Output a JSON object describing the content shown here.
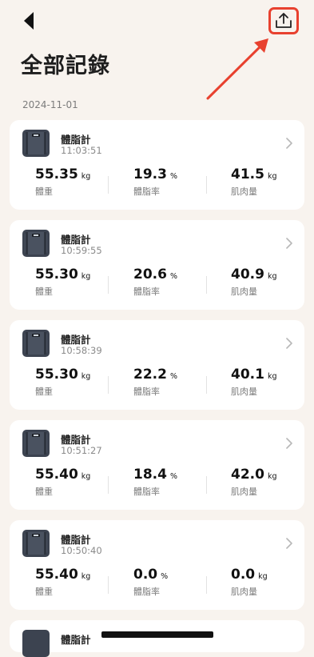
{
  "header": {
    "title": "全部記錄",
    "back_icon": "back-arrow-icon",
    "export_icon": "share-upload-icon",
    "accent_color": "#e8412f"
  },
  "date_group": "2024-11-01",
  "records": [
    {
      "device": "體脂計",
      "time": "11:03:51",
      "weight": "55.35",
      "weight_unit": "kg",
      "weight_label": "體重",
      "fat": "19.3",
      "fat_unit": "%",
      "fat_label": "體脂率",
      "muscle": "41.5",
      "muscle_unit": "kg",
      "muscle_label": "肌肉量"
    },
    {
      "device": "體脂計",
      "time": "10:59:55",
      "weight": "55.30",
      "weight_unit": "kg",
      "weight_label": "體重",
      "fat": "20.6",
      "fat_unit": "%",
      "fat_label": "體脂率",
      "muscle": "40.9",
      "muscle_unit": "kg",
      "muscle_label": "肌肉量"
    },
    {
      "device": "體脂計",
      "time": "10:58:39",
      "weight": "55.30",
      "weight_unit": "kg",
      "weight_label": "體重",
      "fat": "22.2",
      "fat_unit": "%",
      "fat_label": "體脂率",
      "muscle": "40.1",
      "muscle_unit": "kg",
      "muscle_label": "肌肉量"
    },
    {
      "device": "體脂計",
      "time": "10:51:27",
      "weight": "55.40",
      "weight_unit": "kg",
      "weight_label": "體重",
      "fat": "18.4",
      "fat_unit": "%",
      "fat_label": "體脂率",
      "muscle": "42.0",
      "muscle_unit": "kg",
      "muscle_label": "肌肉量"
    },
    {
      "device": "體脂計",
      "time": "10:50:40",
      "weight": "55.40",
      "weight_unit": "kg",
      "weight_label": "體重",
      "fat": "0.0",
      "fat_unit": "%",
      "fat_label": "體脂率",
      "muscle": "0.0",
      "muscle_unit": "kg",
      "muscle_label": "肌肉量"
    }
  ],
  "partial_record": {
    "device": "體脂計"
  }
}
